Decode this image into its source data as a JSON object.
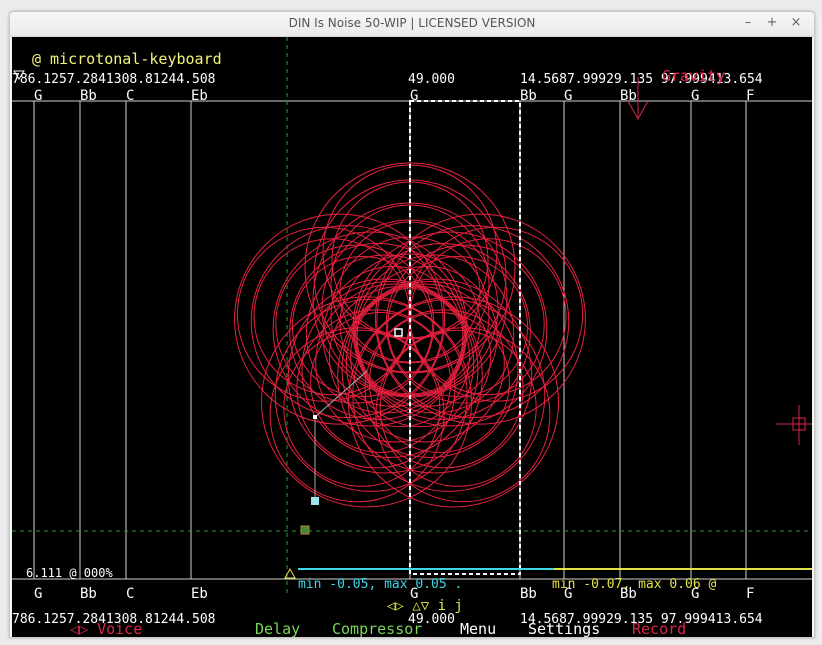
{
  "window": {
    "title": "DIN Is Noise 50-WIP | LICENSED VERSION",
    "minimize": "–",
    "maximize": "+",
    "close": "×"
  },
  "instrument": "@ microtonal-keyboard",
  "top_readout": {
    "left": "786.1257.2841308.81244.508",
    "center": "49.000",
    "right": "14.5687.99929.135 97.999413.654"
  },
  "gravity_label": "Gravity",
  "notes_top": [
    "G",
    "Bb",
    "C",
    "Eb",
    "G",
    "Bb",
    "G",
    "Bb",
    "G",
    "F"
  ],
  "notes_bottom": [
    "G",
    "Bb",
    "C",
    "Eb",
    "G",
    "Bb",
    "G",
    "Bb",
    "G",
    "F"
  ],
  "bottom_readout": {
    "left": "786.1257.2841308.81244.508",
    "center": "49.000",
    "right": "14.5687.99929.135 97.999413.654"
  },
  "volume_readout": "6.111 @ 000%",
  "range_left": "min -0.05, max 0.05 .",
  "range_right": "min -0.07, max 0.06 @",
  "arrows": "◁▷ △▽ i j",
  "menu": {
    "voice": "◁▷ Voice",
    "delay": "Delay",
    "compressor": "Compressor",
    "menu": "Menu",
    "settings": "Settings",
    "record": "Record"
  },
  "colors": {
    "background": "#000000",
    "text": "#ffffff",
    "label_yellow": "#f2f27a",
    "cyan": "#3fd4e6",
    "curve_red": "#e8213f",
    "menu_red": "#d8284a",
    "menu_green": "#79d659",
    "grid_green": "#2f9a2f"
  }
}
